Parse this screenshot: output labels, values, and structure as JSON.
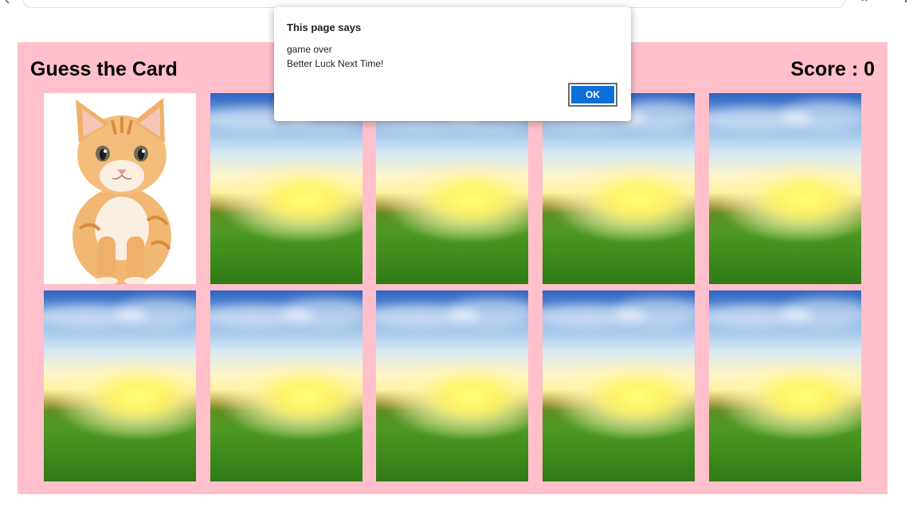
{
  "game": {
    "title": "Guess the Card",
    "score_text": "Score : 0"
  },
  "cards": [
    {
      "face": "cat",
      "label": "kitten card"
    },
    {
      "face": "sunset",
      "label": "sunset card"
    },
    {
      "face": "sunset",
      "label": "sunset card"
    },
    {
      "face": "sunset",
      "label": "sunset card"
    },
    {
      "face": "sunset",
      "label": "sunset card"
    },
    {
      "face": "sunset",
      "label": "sunset card"
    },
    {
      "face": "sunset",
      "label": "sunset card"
    },
    {
      "face": "sunset",
      "label": "sunset card"
    },
    {
      "face": "sunset",
      "label": "sunset card"
    },
    {
      "face": "sunset",
      "label": "sunset card"
    }
  ],
  "dialog": {
    "title": "This page says",
    "line1": "game over",
    "line2": "Better Luck Next Time!",
    "ok_label": "OK"
  },
  "colors": {
    "panel_background": "#ffc0cb",
    "ok_button": "#0a6fd6"
  },
  "icons": [
    "back-icon",
    "extensions-icon",
    "menu-icon"
  ]
}
